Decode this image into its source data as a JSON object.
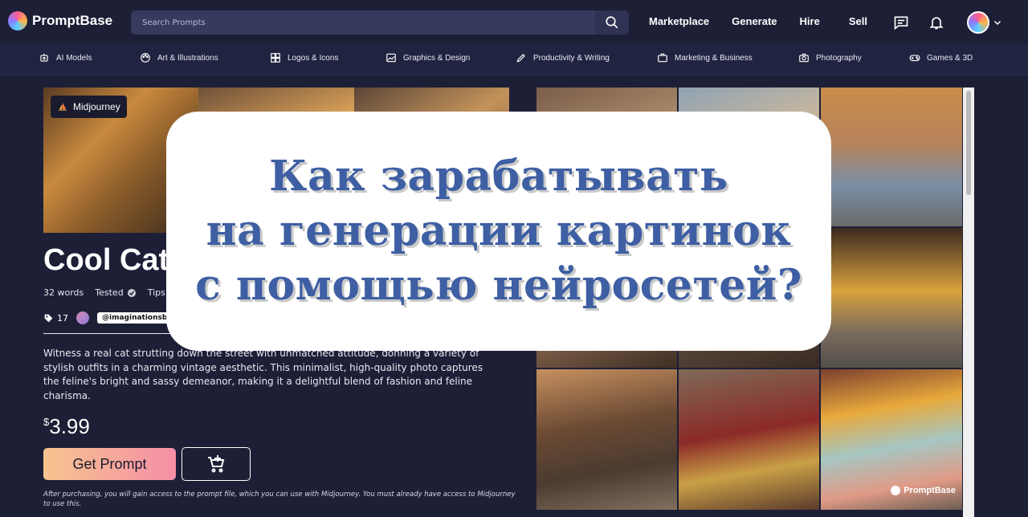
{
  "header": {
    "brand": "PromptBase",
    "search_placeholder": "Search Prompts",
    "nav": [
      "Marketplace",
      "Generate",
      "Hire",
      "Sell"
    ]
  },
  "categories": [
    {
      "label": "AI Models",
      "icon": "robot-icon"
    },
    {
      "label": "Art & Illustrations",
      "icon": "palette-icon"
    },
    {
      "label": "Logos & Icons",
      "icon": "logo-icon"
    },
    {
      "label": "Graphics & Design",
      "icon": "image-icon"
    },
    {
      "label": "Productivity & Writing",
      "icon": "pen-icon"
    },
    {
      "label": "Marketing & Business",
      "icon": "briefcase-icon"
    },
    {
      "label": "Photography",
      "icon": "camera-icon"
    },
    {
      "label": "Games & 3D",
      "icon": "gamepad-icon"
    }
  ],
  "prompt": {
    "model_badge": "Midjourney",
    "title": "Cool Cat",
    "words": "32 words",
    "tested": "Tested",
    "tips": "Tips",
    "tag_count": "17",
    "author": "@imaginationsby",
    "description": "Witness a real cat strutting down the street with unmatched attitude, donning a variety of stylish outfits in a charming vintage aesthetic. This minimalist, high-quality photo captures the feline's bright and sassy demeanor, making it a delightful blend of fashion and feline charisma.",
    "price_symbol": "$",
    "price_value": "3.99",
    "get_button": "Get Prompt",
    "fine_print": "After purchasing, you will gain access to the prompt file, which you can use with Midjourney. You must already have access to Midjourney to use this."
  },
  "gallery": {
    "watermark": "PromptBase"
  },
  "overlay": {
    "lines": [
      "Как зарабатывать",
      "на генерации картинок",
      "с помощью нейросетей?"
    ]
  },
  "colors": {
    "background": "#1d1f36",
    "overlay_text": "#3e5fa3",
    "button_gradient_start": "#f7c48f",
    "button_gradient_end": "#f58ea6"
  }
}
